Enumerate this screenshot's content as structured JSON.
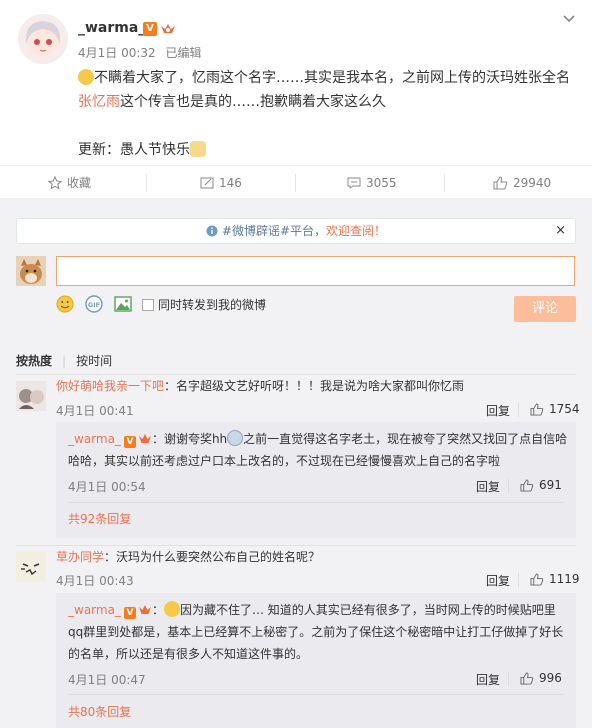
{
  "post": {
    "username": "_warma_",
    "verified_badge": "V",
    "time": "4月1日 00:32",
    "edited": "已编辑",
    "line1_a": "不瞒着大家了，忆雨这个名字……其实是我本名，之前网上传的沃玛姓张全名",
    "line1_name": "张忆雨",
    "line1_b": "这个传言也是真的……抱歉瞒着大家这么久",
    "update": "更新：愚人节快乐"
  },
  "actions": {
    "favorite": "收藏",
    "repost": "146",
    "comment": "3055",
    "like": "29940"
  },
  "notice": {
    "text": "#微博辟谣#平台，",
    "link": "欢迎查阅！",
    "close": "×"
  },
  "composer": {
    "placeholder": "",
    "forward_label": "同时转发到我的微博",
    "submit": "评论"
  },
  "sort": {
    "hot": "按热度",
    "time": "按时间"
  },
  "comments": [
    {
      "user": "你好萌哈我亲一下吧",
      "text": "：名字超级文艺好听呀！！！我是说为啥大家都叫你忆雨",
      "time": "4月1日 00:41",
      "reply": "回复",
      "likes": "1754",
      "sub": {
        "user": "_warma_",
        "text_a": "：谢谢夸奖hh",
        "text_b": "之前一直觉得这名字老土，现在被夸了突然又找回了点自信哈哈哈，其实以前还考虑过户口本上改名的，不过现在已经慢慢喜欢上自己的名字啦",
        "time": "4月1日 00:54",
        "reply": "回复",
        "likes": "691"
      },
      "more": "共92条回复"
    },
    {
      "user": "草办同学",
      "text": "：沃玛为什么要突然公布自己的姓名呢？",
      "time": "4月1日 00:43",
      "reply": "回复",
      "likes": "1119",
      "sub": {
        "user": "_warma_",
        "text_a": "：",
        "text_b": "因为藏不住了… 知道的人其实已经有很多了，当时网上传的时候贴吧里qq群里到处都是，基本上已经算不上秘密了。之前为了保住这个秘密暗中让打工仔做掉了好长的名单，所以还是有很多人不知道这件事的。",
        "time": "4月1日 00:47",
        "reply": "回复",
        "likes": "996"
      },
      "more": "共80条回复"
    }
  ],
  "colors": {
    "accent": "#eb7350",
    "verified": "#f77d1c",
    "submit_disabled": "#fbbd9a",
    "link_blue": "#5a7a9c"
  },
  "icons": [
    "chevron-down-icon",
    "star-icon",
    "repost-icon",
    "comment-icon",
    "thumb-up-icon",
    "info-icon",
    "smiley-icon",
    "gif-icon",
    "image-icon"
  ]
}
